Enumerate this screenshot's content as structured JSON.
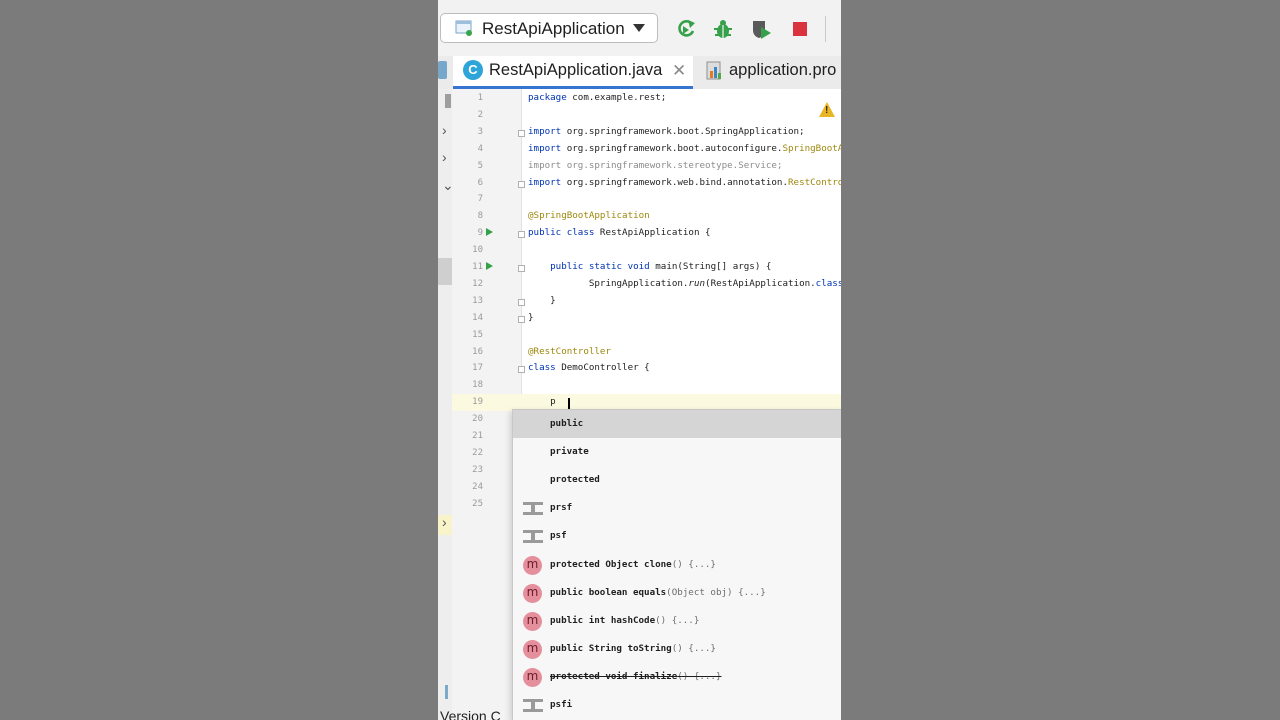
{
  "toolbar": {
    "run_config_label": "RestApiApplication",
    "buttons": [
      "rerun-icon",
      "debug-icon",
      "coverage-icon",
      "stop-icon"
    ]
  },
  "tabs": [
    {
      "label": "RestApiApplication.java",
      "icon": "java-class-icon",
      "active": true
    },
    {
      "label": "application.pro",
      "icon": "properties-file-icon",
      "active": false
    }
  ],
  "editor": {
    "lines": [
      {
        "n": "1",
        "segs": [
          [
            "kw",
            "package"
          ],
          [
            "",
            " com.example.rest;"
          ]
        ]
      },
      {
        "n": "2",
        "segs": []
      },
      {
        "n": "3",
        "segs": [
          [
            "kw",
            "import"
          ],
          [
            "",
            " org.springframework.boot.SpringApplication;"
          ]
        ]
      },
      {
        "n": "4",
        "segs": [
          [
            "kw",
            "import"
          ],
          [
            "",
            " org.springframework.boot.autoconfigure."
          ],
          [
            "ann",
            "SpringBootAp"
          ]
        ]
      },
      {
        "n": "5",
        "segs": [
          [
            "cmt",
            "import org.springframework.stereotype.Service;"
          ]
        ]
      },
      {
        "n": "6",
        "segs": [
          [
            "kw",
            "import"
          ],
          [
            "",
            " org.springframework.web.bind.annotation."
          ],
          [
            "ann",
            "RestControll"
          ]
        ]
      },
      {
        "n": "7",
        "segs": []
      },
      {
        "n": "8",
        "segs": [
          [
            "ann",
            "@SpringBootApplication"
          ]
        ]
      },
      {
        "n": "9",
        "segs": [
          [
            "kw",
            "public class"
          ],
          [
            "",
            " RestApiApplication {"
          ]
        ]
      },
      {
        "n": "10",
        "segs": []
      },
      {
        "n": "11",
        "segs": [
          [
            "",
            "    "
          ],
          [
            "kw",
            "public static void"
          ],
          [
            "",
            " main(String[] args) {"
          ]
        ]
      },
      {
        "n": "12",
        "segs": [
          [
            "",
            "           SpringApplication."
          ],
          [
            "fn",
            "run"
          ],
          [
            "",
            "(RestApiApplication."
          ],
          [
            "kw",
            "class"
          ],
          [
            "",
            ","
          ]
        ]
      },
      {
        "n": "13",
        "segs": [
          [
            "",
            "    }"
          ]
        ]
      },
      {
        "n": "14",
        "segs": [
          [
            "",
            "}"
          ]
        ]
      },
      {
        "n": "15",
        "segs": []
      },
      {
        "n": "16",
        "segs": [
          [
            "ann",
            "@RestController"
          ]
        ]
      },
      {
        "n": "17",
        "segs": [
          [
            "kw",
            "class"
          ],
          [
            "",
            " DemoController {"
          ]
        ]
      },
      {
        "n": "18",
        "segs": []
      },
      {
        "n": "19",
        "segs": [
          [
            "",
            "    p"
          ]
        ]
      },
      {
        "n": "20",
        "segs": []
      },
      {
        "n": "21",
        "segs": []
      },
      {
        "n": "22",
        "segs": []
      },
      {
        "n": "23",
        "segs": []
      },
      {
        "n": "24",
        "segs": []
      },
      {
        "n": "25",
        "segs": []
      }
    ]
  },
  "completion": {
    "items": [
      {
        "main": "public",
        "hint": "",
        "icon": "none",
        "selected": true,
        "deprecated": false
      },
      {
        "main": "private",
        "hint": "",
        "icon": "none",
        "selected": false,
        "deprecated": false
      },
      {
        "main": "protected",
        "hint": "",
        "icon": "none",
        "selected": false,
        "deprecated": false
      },
      {
        "main": "prsf",
        "hint": "",
        "icon": "template-icon",
        "selected": false,
        "deprecated": false
      },
      {
        "main": "psf",
        "hint": "",
        "icon": "template-icon",
        "selected": false,
        "deprecated": false
      },
      {
        "main": "protected Object clone",
        "hint": "() {...}",
        "icon": "method-icon",
        "selected": false,
        "deprecated": false
      },
      {
        "main": "public boolean equals",
        "hint": "(Object obj) {...}",
        "icon": "method-icon",
        "selected": false,
        "deprecated": false
      },
      {
        "main": "public int hashCode",
        "hint": "() {...}",
        "icon": "method-icon",
        "selected": false,
        "deprecated": false
      },
      {
        "main": "public String toString",
        "hint": "() {...}",
        "icon": "method-icon",
        "selected": false,
        "deprecated": false
      },
      {
        "main": "protected void finalize",
        "hint": "() {...}",
        "icon": "method-icon",
        "selected": false,
        "deprecated": true
      },
      {
        "main": "psfi",
        "hint": "",
        "icon": "template-icon",
        "selected": false,
        "deprecated": false
      }
    ],
    "method_icon_letter": "m"
  },
  "bottom": {
    "label": "Version C"
  },
  "colors": {
    "keyword": "#0033b3",
    "annotation": "#9e880d",
    "accent": "#3574d0",
    "run_green": "#33a247"
  }
}
